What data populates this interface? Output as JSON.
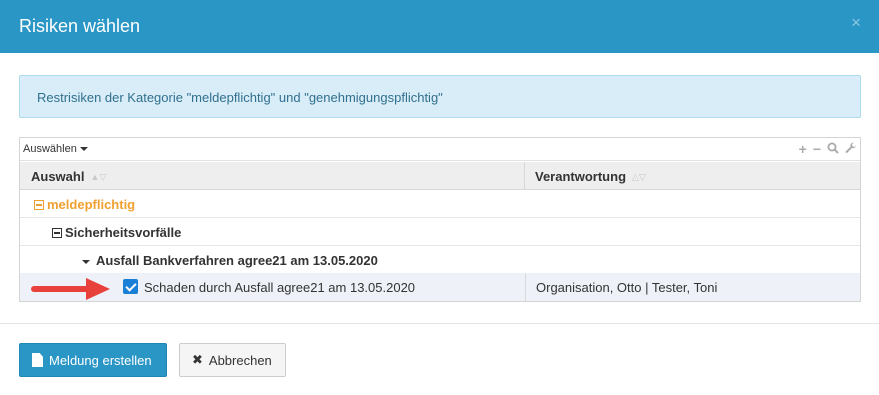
{
  "dialog": {
    "title": "Risiken wählen",
    "close_symbol": "×"
  },
  "alert": {
    "text": "Restrisiken der Kategorie \"meldepflichtig\" und \"genehmigungspflichtig\""
  },
  "grid": {
    "toolbar": {
      "select_label": "Auswählen",
      "icons": [
        "plus-icon",
        "minus-icon",
        "search-icon",
        "wrench-icon"
      ]
    },
    "columns": [
      "Auswahl",
      "Verantwortung"
    ],
    "rows": [
      {
        "label": "meldepflichtig",
        "level": 0,
        "responsible": ""
      },
      {
        "label": "Sicherheitsvorfälle",
        "level": 1,
        "responsible": ""
      },
      {
        "label": "Ausfall Bankverfahren agree21 am 13.05.2020",
        "level": 2,
        "responsible": ""
      },
      {
        "label": "Schaden durch Ausfall agree21 am 13.05.2020",
        "level": 3,
        "checked": true,
        "responsible": "Organisation, Otto | Tester, Toni"
      }
    ]
  },
  "footer": {
    "primary_label": "Meldung erstellen",
    "cancel_label": "Abbrechen"
  },
  "colors": {
    "header": "#2a96c6",
    "category": "#f0a030",
    "annotation_arrow": "#e8413c",
    "checkbox": "#1a7fd6"
  }
}
